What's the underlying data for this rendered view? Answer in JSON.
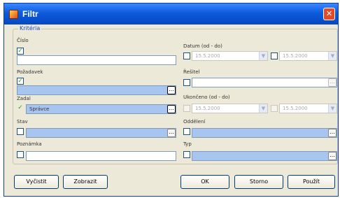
{
  "window": {
    "title": "Filtr",
    "close_glyph": "✕",
    "app_icon": "filter-app-icon"
  },
  "group": {
    "title": "Kritéria"
  },
  "fields": {
    "cislo": {
      "label": "Číslo",
      "value": "",
      "checked": true
    },
    "pozadavek": {
      "label": "Požadavek",
      "value": "",
      "checked": true
    },
    "zadal": {
      "label": "Zadal",
      "value": "Správce",
      "checked": true
    },
    "stav": {
      "label": "Stav",
      "value": "",
      "checked": false
    },
    "poznamka": {
      "label": "Poznámka",
      "value": "",
      "checked": false
    },
    "datum": {
      "label": "Datum (od - do)",
      "from": "15.5.2000",
      "to": "15.5.2000",
      "checked_from": false,
      "checked_to": false
    },
    "resitel": {
      "label": "Řešitel",
      "value": "",
      "checked": false
    },
    "ukonceno": {
      "label": "Ukončeno (od - do)",
      "from": "15.5.2000",
      "to": "15.5.2000"
    },
    "oddeleni": {
      "label": "Oddělení",
      "value": "",
      "checked": false
    },
    "typ": {
      "label": "Typ",
      "value": "",
      "checked": false
    }
  },
  "buttons": {
    "clear": "Vyčistit",
    "show": "Zobrazit",
    "ok": "OK",
    "cancel": "Storno",
    "apply": "Použít"
  },
  "colors": {
    "title_bar": "#0b5bdc",
    "check_green": "#21a121",
    "field_highlight": "#a8c5f0"
  }
}
